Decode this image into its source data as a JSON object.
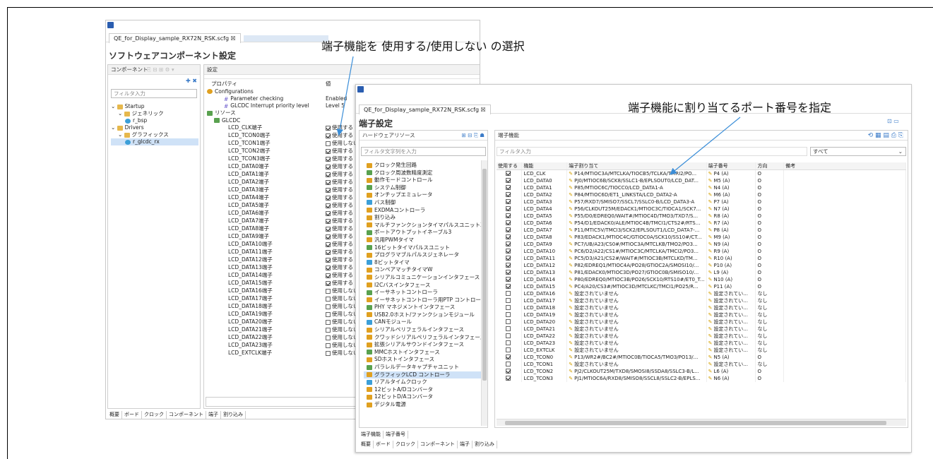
{
  "annotations": {
    "select_label": "端子機能を 使用する/使用しない の選択",
    "port_label": "端子機能に割り当てるポート番号を指定"
  },
  "back_window": {
    "tab_title": "QE_for_Display_sample_RX72N_RSK.scfg ☒",
    "page_title": "ソフトウェアコンポーネント設定",
    "components_header": "コンポーネント",
    "settings_header": "設定",
    "filter_placeholder": "フィルタ入力",
    "tree": [
      {
        "label": "Startup",
        "icon": "folder-icon",
        "level": 0
      },
      {
        "label": "ジェネリック",
        "icon": "folder-icon",
        "level": 1
      },
      {
        "label": "r_bsp",
        "icon": "component-icon",
        "level": 2
      },
      {
        "label": "Drivers",
        "icon": "folder-icon",
        "level": 0
      },
      {
        "label": "グラフィックス",
        "icon": "folder-icon",
        "level": 1
      },
      {
        "label": "r_glcdc_rx",
        "icon": "component-icon",
        "level": 2,
        "selected": true
      }
    ],
    "prop_header": {
      "property": "プロパティ",
      "value": "値"
    },
    "configurations": "Configurations",
    "config_rows": [
      {
        "name": "Parameter checking",
        "value": "Enabled"
      },
      {
        "name": "GLCDC Interrupt priority level",
        "value": "Level 5"
      }
    ],
    "resources": "リソース",
    "glcdc": "GLCDC",
    "pins": [
      {
        "name": "LCD_CLK端子",
        "use": true
      },
      {
        "name": "LCD_TCON0端子",
        "use": true
      },
      {
        "name": "LCD_TCON1端子",
        "use": false
      },
      {
        "name": "LCD_TCON2端子",
        "use": true
      },
      {
        "name": "LCD_TCON3端子",
        "use": true
      },
      {
        "name": "LCD_DATA0端子",
        "use": true
      },
      {
        "name": "LCD_DATA1端子",
        "use": true
      },
      {
        "name": "LCD_DATA2端子",
        "use": true
      },
      {
        "name": "LCD_DATA3端子",
        "use": true
      },
      {
        "name": "LCD_DATA4端子",
        "use": true
      },
      {
        "name": "LCD_DATA5端子",
        "use": true
      },
      {
        "name": "LCD_DATA6端子",
        "use": true
      },
      {
        "name": "LCD_DATA7端子",
        "use": true
      },
      {
        "name": "LCD_DATA8端子",
        "use": true
      },
      {
        "name": "LCD_DATA9端子",
        "use": true
      },
      {
        "name": "LCD_DATA10端子",
        "use": true
      },
      {
        "name": "LCD_DATA11端子",
        "use": true
      },
      {
        "name": "LCD_DATA12端子",
        "use": true
      },
      {
        "name": "LCD_DATA13端子",
        "use": true
      },
      {
        "name": "LCD_DATA14端子",
        "use": true
      },
      {
        "name": "LCD_DATA15端子",
        "use": true
      },
      {
        "name": "LCD_DATA16端子",
        "use": false
      },
      {
        "name": "LCD_DATA17端子",
        "use": false
      },
      {
        "name": "LCD_DATA18端子",
        "use": false
      },
      {
        "name": "LCD_DATA19端子",
        "use": false
      },
      {
        "name": "LCD_DATA20端子",
        "use": false
      },
      {
        "name": "LCD_DATA21端子",
        "use": false
      },
      {
        "name": "LCD_DATA22端子",
        "use": false
      },
      {
        "name": "LCD_DATA23端子",
        "use": false
      },
      {
        "name": "LCD_EXTCLK端子",
        "use": false
      }
    ],
    "use_label": "使用する",
    "nouse_label": "使用しない",
    "bottom_tabs": [
      "概要",
      "ボード",
      "クロック",
      "コンポーネント",
      "端子",
      "割り込み"
    ]
  },
  "front_window": {
    "tab_title": "QE_for_Display_sample_RX72N_RSK.scfg ☒",
    "page_title": "端子設定",
    "hw_header": "ハードウェアリソース",
    "pf_header": "端子機能",
    "hw_filter": "フィルタ文字列を入力",
    "pf_filter": "フィルタ入力",
    "dropdown": "すべて",
    "hw_tree": [
      "クロック発生回路",
      "クロック周波数精度測定",
      "動作モードコントロール",
      "システム制御",
      "オンチップエミュレータ",
      "バス制御",
      "EXDMAコントローラ",
      "割り込み",
      "マルチファンクションタイマパルスユニット3",
      "ポートアウトプットイネーブル3",
      "汎用PWMタイマ",
      "16ビットタイマパルスユニット",
      "プログラマブルパルスジェネレータ",
      "8ビットタイマ",
      "コンペアマッチタイマW",
      "シリアルコミュニケーションインタフェース",
      "I2Cバスインタフェース",
      "イーサネットコントローラ",
      "イーサネットコントローラ用PTP コントローラ",
      "PHY マネジメントインタフェース",
      "USB2.0ホスト/ファンクションモジュール",
      "CANモジュール",
      "シリアルペリフェラルインタフェース",
      "クワッドシリアルペリフェラルインタフェース",
      "拡張シリアルサウンドインタフェース",
      "MMCホストインタフェース",
      "SDホストインタフェース",
      "パラレルデータキャプチャユニット",
      "グラフィックLCD コントローラ",
      "リアルタイムクロック",
      "12ビットA/Dコンバータ",
      "12ビットD/Aコンバータ",
      "デジタル電源"
    ],
    "hw_selected": 28,
    "columns": [
      "使用する",
      "機能",
      "端子割り当て",
      "端子番号",
      "方向",
      "備考"
    ],
    "rows": [
      {
        "use": true,
        "func": "LCD_CLK",
        "assign": "P14/MTIOC3A/MTCLKA/TIOCB5/TCLKA/TMRI2/PO...",
        "pin": "P4 (A)",
        "dir": "O"
      },
      {
        "use": true,
        "func": "LCD_DATA0",
        "assign": "PJ0/MTIOC6B/SCK8/SSLC1-B/EPLSOUT0/LCD_DAT...",
        "pin": "M5 (A)",
        "dir": "O"
      },
      {
        "use": true,
        "func": "LCD_DATA1",
        "assign": "P85/MTIOC6C/TIOCC0/LCD_DATA1-A",
        "pin": "N4 (A)",
        "dir": "O"
      },
      {
        "use": true,
        "func": "LCD_DATA2",
        "assign": "P84/MTIOC6D/ET1_LINKSTA/LCD_DATA2-A",
        "pin": "M6 (A)",
        "dir": "O"
      },
      {
        "use": true,
        "func": "LCD_DATA3",
        "assign": "P57/RXD7/SMISO7/SSCL7/SSLC0-B/LCD_DATA3-A",
        "pin": "P7 (A)",
        "dir": "O"
      },
      {
        "use": true,
        "func": "LCD_DATA4",
        "assign": "P56/CLKOUT25M/EDACK1/MTIOC3C/TIOCA1/SCK7...",
        "pin": "N7 (A)",
        "dir": "O"
      },
      {
        "use": true,
        "func": "LCD_DATA5",
        "assign": "P55/D0/EDREQ0/WAIT#/MTIOC4D/TMO3/TXD7/S...",
        "pin": "R8 (A)",
        "dir": "O"
      },
      {
        "use": true,
        "func": "LCD_DATA6",
        "assign": "P54/D1/EDACK0/ALE/MTIOC4B/TMCI1/CTS2#/RTS...",
        "pin": "R7 (A)",
        "dir": "O"
      },
      {
        "use": true,
        "func": "LCD_DATA7",
        "assign": "P11/MTIC5V/TMCI3/SCK2/EPLSOUT1/LCD_DATA7-...",
        "pin": "P8 (A)",
        "dir": "O"
      },
      {
        "use": true,
        "func": "LCD_DATA8",
        "assign": "P83/EDACK1/MTIOC4C/GTIOC0A/SCK10/SS10#/CT...",
        "pin": "M9 (A)",
        "dir": "O"
      },
      {
        "use": true,
        "func": "LCD_DATA9",
        "assign": "PC7/UB/A23/CS0#/MTIOC3A/MTCLKB/TMO2/PO3...",
        "pin": "N9 (A)",
        "dir": "O"
      },
      {
        "use": true,
        "func": "LCD_DATA10",
        "assign": "PC6/D2/A22/CS1#/MTIOC3C/MTCLKA/TMCI2/PO3...",
        "pin": "R9 (A)",
        "dir": "O"
      },
      {
        "use": true,
        "func": "LCD_DATA11",
        "assign": "PC5/D3/A21/CS2#/WAIT#/MTIOC3B/MTCLKD/TM...",
        "pin": "R10 (A)",
        "dir": "O"
      },
      {
        "use": true,
        "func": "LCD_DATA12",
        "assign": "P82/EDREQ1/MTIOC4A/PO28/GTIOC2A/SMOSI10/...",
        "pin": "P10 (A)",
        "dir": "O"
      },
      {
        "use": true,
        "func": "LCD_DATA13",
        "assign": "P81/EDACK0/MTIOC3D/PO27/GTIOC0B/SMISO10/...",
        "pin": "L9 (A)",
        "dir": "O"
      },
      {
        "use": true,
        "func": "LCD_DATA14",
        "assign": "P80/EDREQ0/MTIOC3B/PO26/SCK10/RTS10#/ET0_T...",
        "pin": "N10 (A)",
        "dir": "O"
      },
      {
        "use": true,
        "func": "LCD_DATA15",
        "assign": "PC4/A20/CS3#/MTIOC3D/MTCLKC/TMCI1/PO25/R...",
        "pin": "P11 (A)",
        "dir": "O"
      },
      {
        "use": false,
        "func": "LCD_DATA16",
        "assign": "設定されていません",
        "pin": "設定されてい...",
        "dir": "なし"
      },
      {
        "use": false,
        "func": "LCD_DATA17",
        "assign": "設定されていません",
        "pin": "設定されてい...",
        "dir": "なし"
      },
      {
        "use": false,
        "func": "LCD_DATA18",
        "assign": "設定されていません",
        "pin": "設定されてい...",
        "dir": "なし"
      },
      {
        "use": false,
        "func": "LCD_DATA19",
        "assign": "設定されていません",
        "pin": "設定されてい...",
        "dir": "なし"
      },
      {
        "use": false,
        "func": "LCD_DATA20",
        "assign": "設定されていません",
        "pin": "設定されてい...",
        "dir": "なし"
      },
      {
        "use": false,
        "func": "LCD_DATA21",
        "assign": "設定されていません",
        "pin": "設定されてい...",
        "dir": "なし"
      },
      {
        "use": false,
        "func": "LCD_DATA22",
        "assign": "設定されていません",
        "pin": "設定されてい...",
        "dir": "なし"
      },
      {
        "use": false,
        "func": "LCD_DATA23",
        "assign": "設定されていません",
        "pin": "設定されてい...",
        "dir": "なし"
      },
      {
        "use": false,
        "func": "LCD_EXTCLK",
        "assign": "設定されていません",
        "pin": "設定されてい...",
        "dir": "なし"
      },
      {
        "use": true,
        "func": "LCD_TCON0",
        "assign": "P13/WR2#/BC2#/MTIOC0B/TIOCA5/TMO3/PO13/...",
        "pin": "N5 (A)",
        "dir": "O"
      },
      {
        "use": false,
        "func": "LCD_TCON1",
        "assign": "設定されていません",
        "pin": "設定されてい...",
        "dir": "なし"
      },
      {
        "use": true,
        "func": "LCD_TCON2",
        "assign": "PJ2/CLKOUT25M/TXD8/SMOSI8/SSDA8/SSLC3-B/L...",
        "pin": "L6 (A)",
        "dir": "O"
      },
      {
        "use": true,
        "func": "LCD_TCON3",
        "assign": "PJ1/MTIOC6A/RXD8/SMISO8/SSCL8/SSLC2-B/EPLS...",
        "pin": "N6 (A)",
        "dir": "O"
      }
    ],
    "bottom_tabs1": [
      "端子機能",
      "端子番号"
    ],
    "bottom_tabs2": [
      "概要",
      "ボード",
      "クロック",
      "コンポーネント",
      "端子",
      "割り込み"
    ]
  },
  "colors": {
    "accent": "#3b7bc8",
    "selection": "#cfe2f7",
    "arrow": "#3b8ed8"
  }
}
